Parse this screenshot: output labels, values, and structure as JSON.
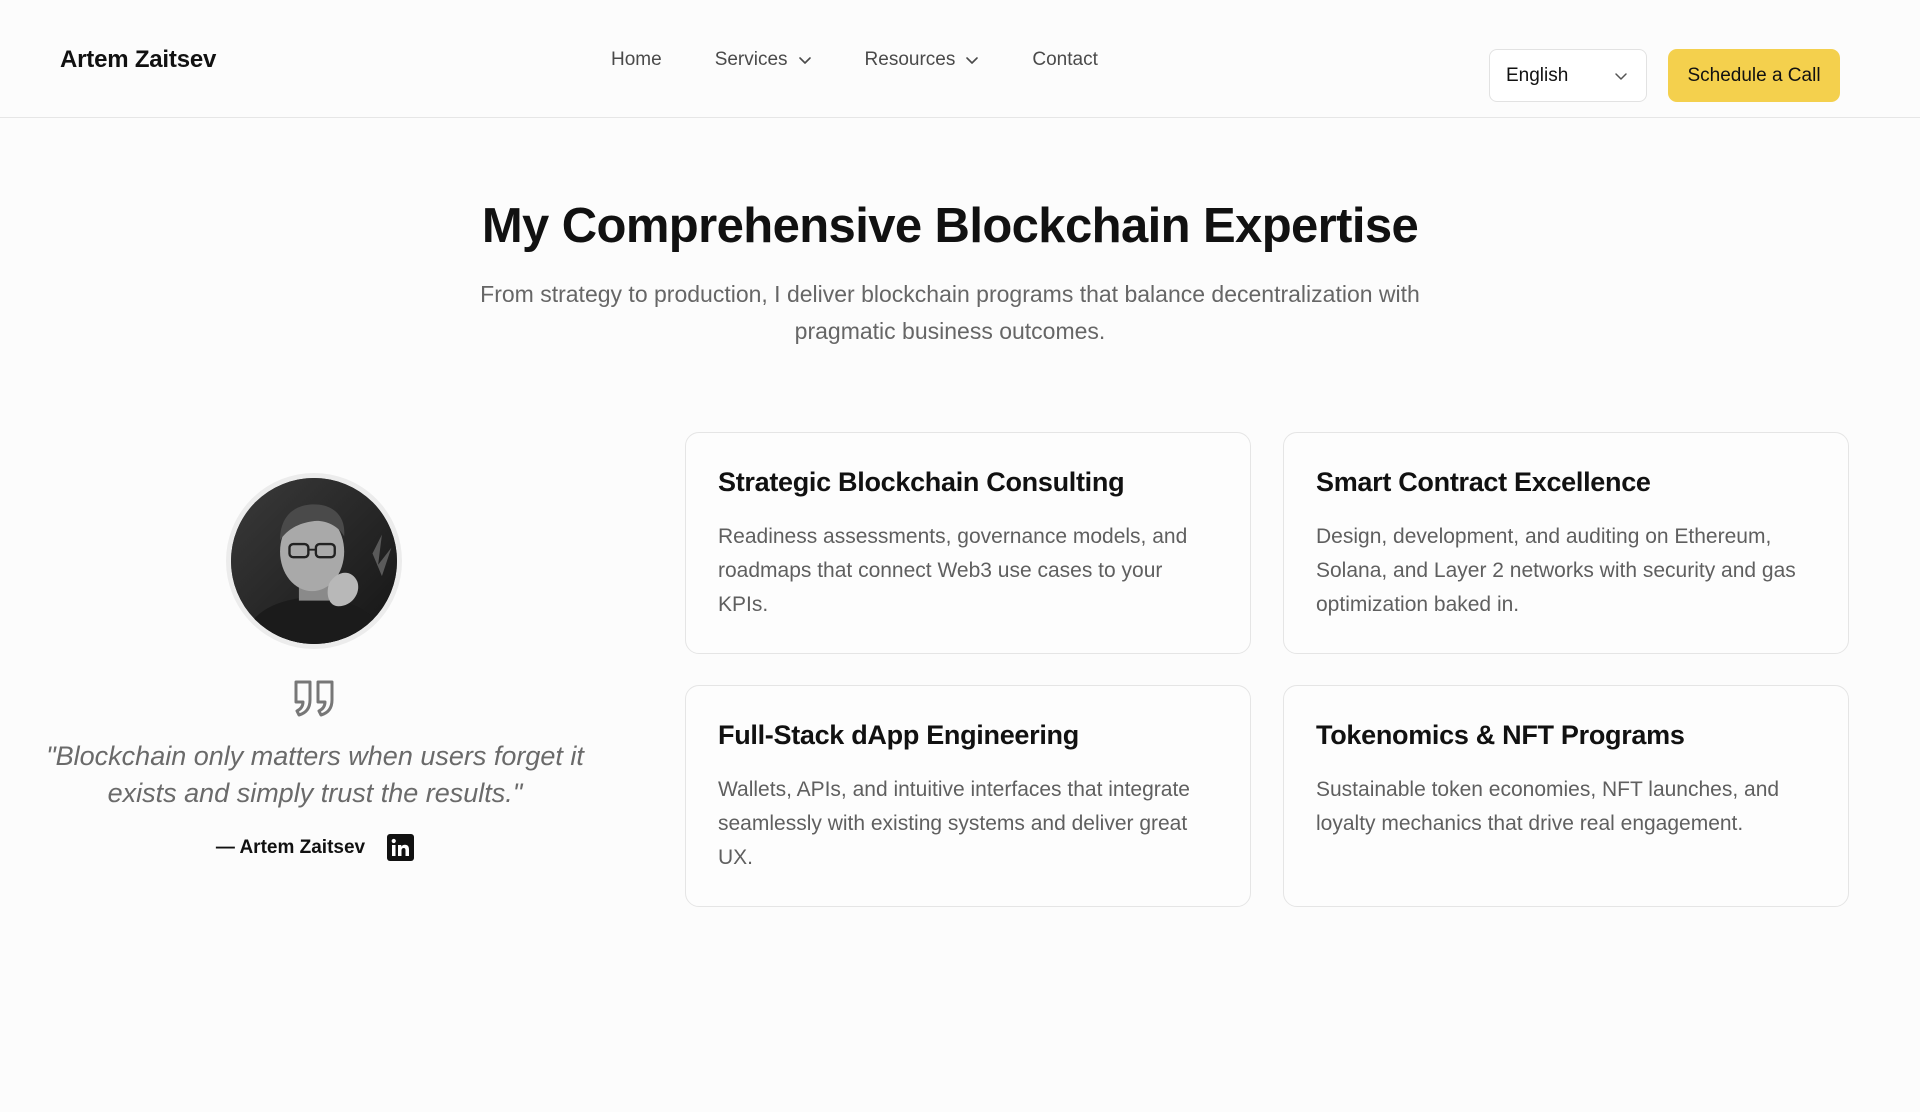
{
  "header": {
    "brand": "Artem Zaitsev",
    "nav": [
      {
        "label": "Home",
        "has_dropdown": false
      },
      {
        "label": "Services",
        "has_dropdown": true
      },
      {
        "label": "Resources",
        "has_dropdown": true
      },
      {
        "label": "Contact",
        "has_dropdown": false
      }
    ],
    "language": {
      "selected": "English"
    },
    "cta_label": "Schedule a Call"
  },
  "hero": {
    "title": "My Comprehensive Blockchain Expertise",
    "subtitle": "From strategy to production, I deliver blockchain programs that balance decentralization with pragmatic business outcomes."
  },
  "profile": {
    "avatar_icon": "portrait-photo",
    "quote_icon": "quote-icon",
    "quote": "\"Blockchain only matters when users forget it exists and simply trust the results.\"",
    "author": "— Artem Zaitsev",
    "social_icon": "linkedin-icon"
  },
  "services": [
    {
      "title": "Strategic Blockchain Consulting",
      "description": "Readiness assessments, governance models, and roadmaps that connect Web3 use cases to your KPIs."
    },
    {
      "title": "Smart Contract Excellence",
      "description": "Design, development, and auditing on Ethereum, Solana, and Layer 2 networks with security and gas optimization baked in."
    },
    {
      "title": "Full-Stack dApp Engineering",
      "description": "Wallets, APIs, and intuitive interfaces that integrate seamlessly with existing systems and deliver great UX."
    },
    {
      "title": "Tokenomics & NFT Programs",
      "description": "Sustainable token economies, NFT launches, and loyalty mechanics that drive real engagement."
    }
  ],
  "colors": {
    "accent": "#f4d04d",
    "background": "#fcfcfc",
    "text": "#111111",
    "muted_text": "#666666"
  }
}
